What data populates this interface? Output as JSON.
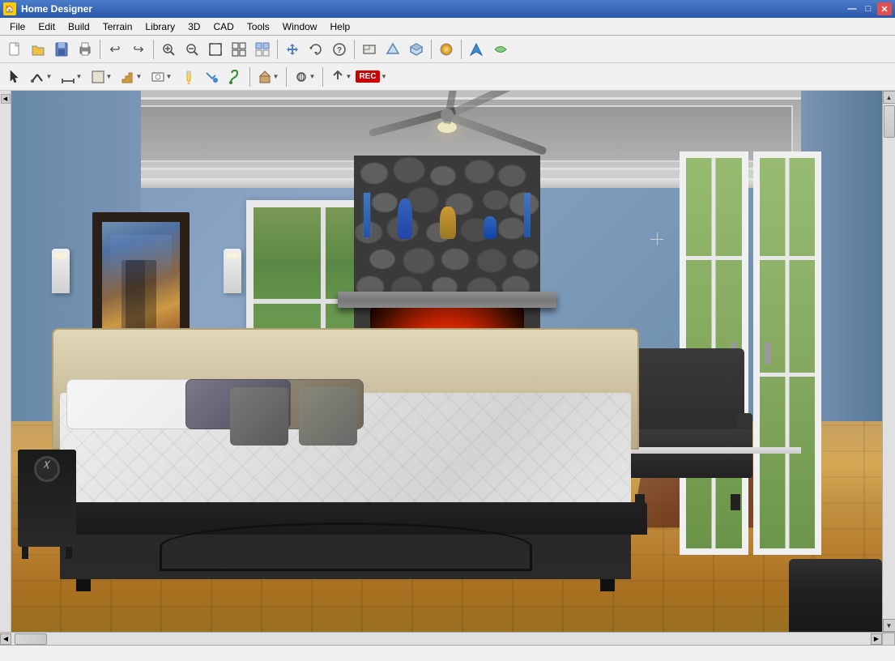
{
  "window": {
    "title": "Home Designer",
    "icon": "🏠"
  },
  "titlebar": {
    "minimize": "—",
    "maximize": "□",
    "close": "✕"
  },
  "menu": {
    "items": [
      "File",
      "Edit",
      "Build",
      "Terrain",
      "Library",
      "3D",
      "CAD",
      "Tools",
      "Window",
      "Help"
    ]
  },
  "toolbar1": {
    "buttons": [
      {
        "id": "new",
        "label": "New",
        "icon": "📄"
      },
      {
        "id": "open",
        "label": "Open",
        "icon": "📂"
      },
      {
        "id": "save",
        "label": "Save",
        "icon": "💾"
      },
      {
        "id": "print",
        "label": "Print",
        "icon": "🖨"
      },
      {
        "id": "undo",
        "label": "Undo",
        "icon": "↩"
      },
      {
        "id": "redo",
        "label": "Redo",
        "icon": "↪"
      }
    ]
  },
  "statusbar": {
    "text": ""
  },
  "viewport": {
    "type": "3d_view",
    "scene": "bedroom"
  }
}
